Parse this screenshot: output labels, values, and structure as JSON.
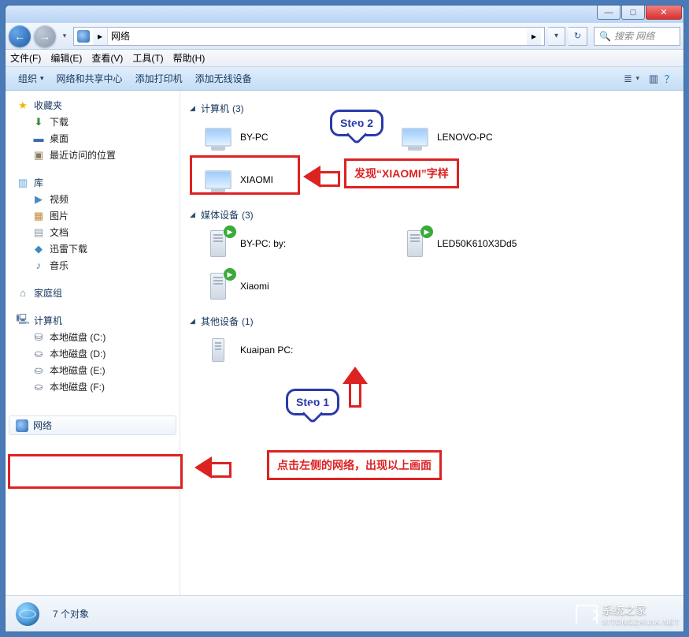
{
  "window": {
    "min": "—",
    "max": "▢",
    "close": "✕"
  },
  "nav": {
    "back": "←",
    "fwd": "→",
    "address_root": "网络",
    "crumb_sep": "▸",
    "dropdown": "▾",
    "refresh": "↻",
    "search_placeholder": "搜索 网络",
    "search_icon": "🔍"
  },
  "menu": {
    "file": "文件(F)",
    "edit": "编辑(E)",
    "view": "查看(V)",
    "tools": "工具(T)",
    "help": "帮助(H)"
  },
  "toolbar": {
    "organize": "组织",
    "dropdown": "▾",
    "network_center": "网络和共享中心",
    "add_printer": "添加打印机",
    "add_wireless": "添加无线设备",
    "view_icon": "≣",
    "preview_icon": "▥",
    "help_icon": "？"
  },
  "sidebar": {
    "favorites": {
      "label": "收藏夹",
      "items": [
        "下载",
        "桌面",
        "最近访问的位置"
      ]
    },
    "library": {
      "label": "库",
      "items": [
        "视频",
        "图片",
        "文档",
        "迅雷下载",
        "音乐"
      ]
    },
    "homegroup": {
      "label": "家庭组"
    },
    "computer": {
      "label": "计算机",
      "items": [
        "本地磁盘 (C:)",
        "本地磁盘 (D:)",
        "本地磁盘 (E:)",
        "本地磁盘 (F:)"
      ]
    },
    "network": {
      "label": "网络"
    }
  },
  "sections": {
    "computers": {
      "label": "计算机",
      "count": "(3)",
      "items": [
        "BY-PC",
        "XIAOMI",
        "LENOVO-PC"
      ]
    },
    "media": {
      "label": "媒体设备",
      "count": "(3)",
      "items": [
        "BY-PC: by:",
        "Xiaomi",
        "LED50K610X3Dd5"
      ]
    },
    "other": {
      "label": "其他设备",
      "count": "(1)",
      "items": [
        "Kuaipan PC:"
      ]
    }
  },
  "annotations": {
    "step2": "Step 2",
    "step1": "Step 1",
    "found_xiaomi": "发现“XIAOMI”字样",
    "click_network": "点击左侧的网络，出现以上画面"
  },
  "status": {
    "text": "7 个对象"
  },
  "watermark": {
    "title": "系统之家",
    "sub": "XITONGZHIJIA.NET"
  }
}
